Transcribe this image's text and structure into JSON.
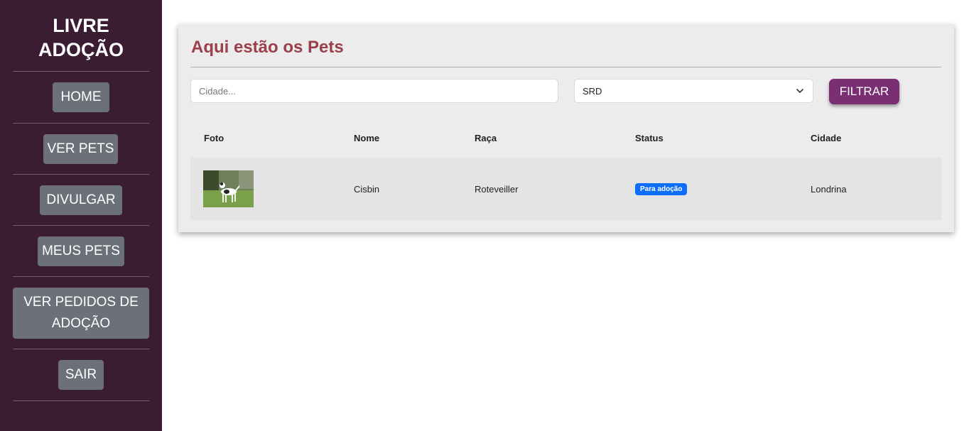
{
  "brand": {
    "line1": "LIVRE",
    "line2": "ADOÇÃO"
  },
  "nav": {
    "home": "HOME",
    "ver_pets": "VER PETS",
    "divulgar": "DIVULGAR",
    "meus_pets": "MEUS PETS",
    "pedidos_line1": "VER PEDIDOS DE",
    "pedidos_line2": "ADOÇÃO",
    "sair": "SAIR"
  },
  "main": {
    "title": "Aqui estão os Pets",
    "city_placeholder": "Cidade...",
    "breed_selected": "SRD",
    "filter_label": "FILTRAR"
  },
  "table": {
    "headers": {
      "foto": "Foto",
      "nome": "Nome",
      "raca": "Raça",
      "status": "Status",
      "cidade": "Cidade"
    },
    "rows": [
      {
        "nome": "Cisbin",
        "raca": "Roteveiller",
        "status": "Para adoção",
        "cidade": "Londrina"
      }
    ]
  },
  "colors": {
    "sidebar": "#3a1c33",
    "nav_button": "#6b7079",
    "title": "#9a3f4b",
    "filter_button": "#7a2e73",
    "status_badge": "#0d6efd"
  }
}
